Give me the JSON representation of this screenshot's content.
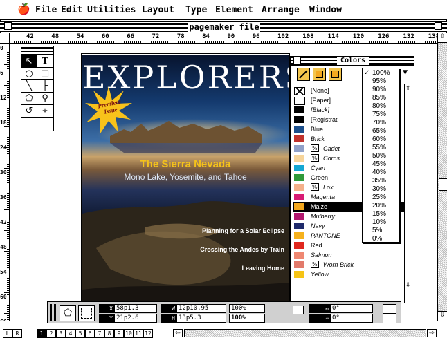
{
  "menubar": {
    "apple": "",
    "items": [
      "File",
      "Edit",
      "Utilities",
      "Layout",
      "Type",
      "Element",
      "Arrange",
      "Window"
    ]
  },
  "window": {
    "title": "pagemaker file"
  },
  "ruler": {
    "h_labels": [
      "42",
      "48",
      "54",
      "60",
      "66",
      "72",
      "78",
      "84",
      "90",
      "96",
      "102",
      "108",
      "114",
      "120",
      "126",
      "132",
      "138"
    ],
    "v_labels": [
      "0",
      "6",
      "12",
      "18",
      "24",
      "30",
      "36",
      "42",
      "48",
      "54",
      "60",
      "66"
    ]
  },
  "toolbox": {
    "tools": [
      "pointer-tool",
      "text-tool",
      "rotate-tool",
      "crop-tool",
      "line-tool",
      "perp-line-tool",
      "rect-tool",
      "ellipse-tool",
      "polygon-tool",
      "zoom-tool"
    ]
  },
  "cover": {
    "masthead": "EXPLORERS",
    "starburst": "Premiere Issue",
    "headline": "The Sierra Nevada",
    "subhead": "Mono Lake, Yosemite, and Tahoe",
    "lines": [
      "Planning for a Solar Eclipse",
      "Crossing the Andes by Train",
      "Leaving Home"
    ]
  },
  "colors": {
    "title": "Colors",
    "selected": "Maize",
    "items": [
      {
        "name": "[None]",
        "color": "none",
        "italic": false
      },
      {
        "name": "[Paper]",
        "color": "#ffffff",
        "italic": false
      },
      {
        "name": "[Black]",
        "color": "#000000",
        "italic": true
      },
      {
        "name": "[Registrat",
        "color": "#000000",
        "italic": false
      },
      {
        "name": "Blue",
        "color": "#1b4f8c",
        "italic": false
      },
      {
        "name": "Brick",
        "color": "#c0322c",
        "italic": true
      },
      {
        "name": "Cadet",
        "color": "#8fa0c8",
        "italic": true,
        "tint": true
      },
      {
        "name": "Corns",
        "color": "#f6d49a",
        "italic": true,
        "tint": true
      },
      {
        "name": "Cyan",
        "color": "#14a7d3",
        "italic": true
      },
      {
        "name": "Green",
        "color": "#2f9a3a",
        "italic": false
      },
      {
        "name": "Lox",
        "color": "#f4b08a",
        "italic": true,
        "tint": true
      },
      {
        "name": "Magenta",
        "color": "#d81b74",
        "italic": true
      },
      {
        "name": "Maize",
        "color": "#f3a81f",
        "italic": false
      },
      {
        "name": "Mulberry",
        "color": "#b2176e",
        "italic": true
      },
      {
        "name": "Navy",
        "color": "#1f2a6b",
        "italic": true
      },
      {
        "name": "PANTONE",
        "color": "#f6b11c",
        "italic": true
      },
      {
        "name": "Red",
        "color": "#e0281e",
        "italic": false
      },
      {
        "name": "Salmon",
        "color": "#ef8872",
        "italic": true
      },
      {
        "name": "Worn Brick",
        "color": "#e27a6b",
        "italic": true,
        "tint": true
      },
      {
        "name": "Yellow",
        "color": "#f6c415",
        "italic": true
      }
    ]
  },
  "tint_menu": {
    "checked": "100%",
    "items": [
      "100%",
      "95%",
      "90%",
      "85%",
      "80%",
      "75%",
      "70%",
      "65%",
      "60%",
      "55%",
      "50%",
      "45%",
      "40%",
      "35%",
      "30%",
      "25%",
      "20%",
      "15%",
      "10%",
      "5%",
      "0%"
    ]
  },
  "control": {
    "x_label": "X",
    "x_value": "58p1.3",
    "y_label": "Y",
    "y_value": "21p2.6",
    "w_label": "W",
    "w_value": "12p10.95",
    "h_label": "H",
    "h_value": "13p5.3",
    "scale_x": "100%",
    "scale_y": "100%",
    "rotation": "0°",
    "skew": "0°"
  },
  "pages": {
    "master_left": "L",
    "master_right": "R",
    "current": "1",
    "numbers": [
      "1",
      "2",
      "3",
      "4",
      "5",
      "6",
      "7",
      "8",
      "9",
      "10",
      "11",
      "12"
    ]
  }
}
